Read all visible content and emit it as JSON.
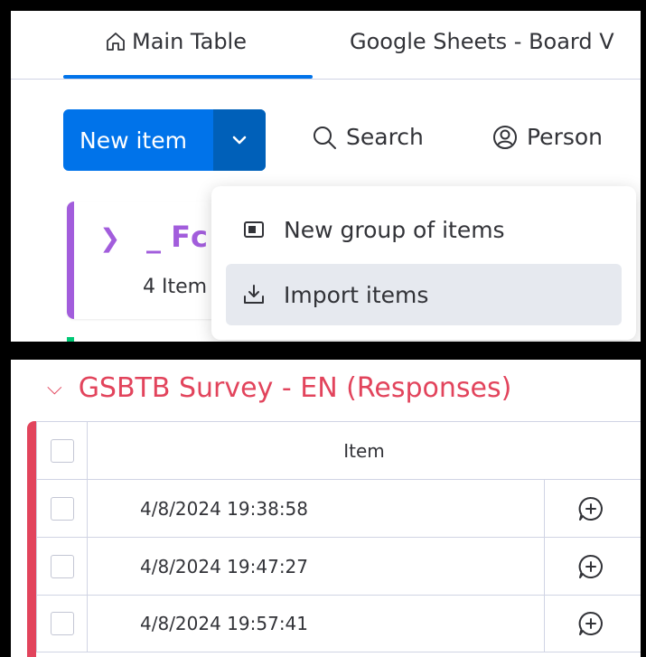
{
  "tabs": {
    "main_table": "Main Table",
    "google_sheets": "Google Sheets - Board V"
  },
  "toolbar": {
    "new_item_label": "New item",
    "search_label": "Search",
    "person_label": "Person"
  },
  "group": {
    "title": "_ Fc",
    "count": "4 Item",
    "color": "#a25ddc"
  },
  "dropdown": {
    "items": [
      {
        "label": "New group of items",
        "icon": "group-icon"
      },
      {
        "label": "Import items",
        "icon": "import-icon"
      }
    ]
  },
  "survey": {
    "title": "GSBTB Survey - EN (Responses)",
    "color": "#e2445c",
    "column_header": "Item",
    "rows": [
      {
        "item": "4/8/2024 19:38:58"
      },
      {
        "item": "4/8/2024 19:47:27"
      },
      {
        "item": "4/8/2024 19:57:41"
      }
    ]
  },
  "colors": {
    "primary": "#0073ea",
    "primary_dark": "#0060b9",
    "text": "#323338",
    "border": "#d0d4e4"
  }
}
